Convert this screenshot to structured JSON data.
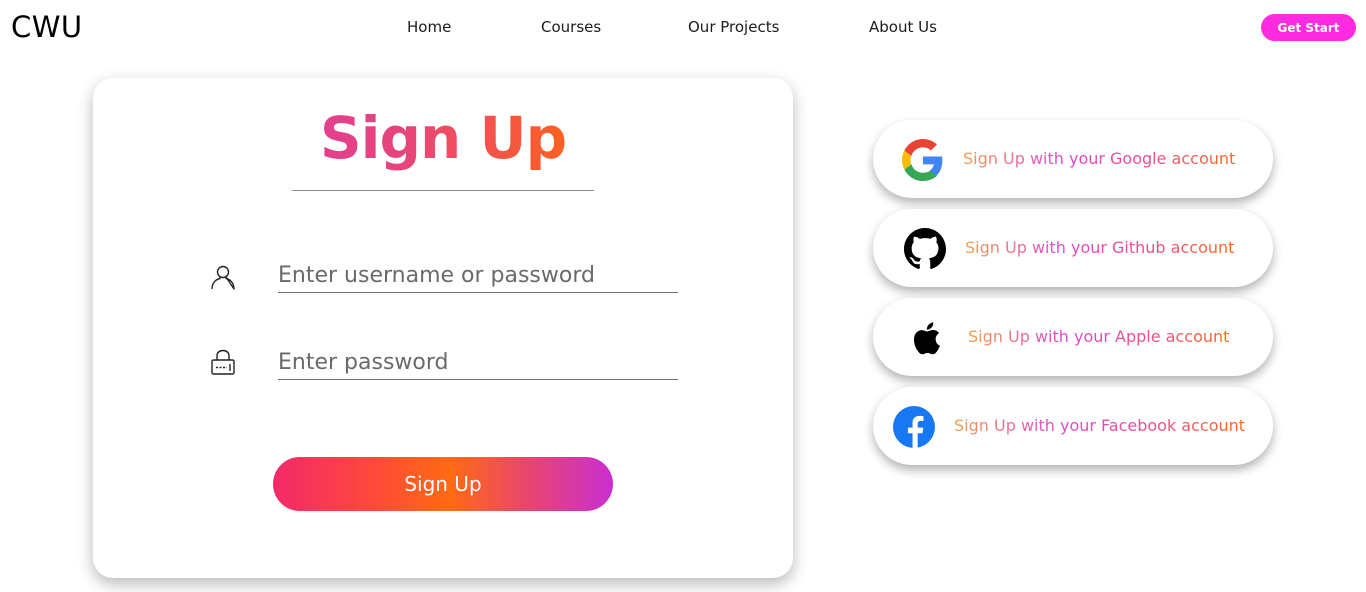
{
  "header": {
    "logo": "CWU",
    "nav": [
      "Home",
      "Courses",
      "Our Projects",
      "About Us"
    ],
    "cta_label": "Get Start"
  },
  "signup_card": {
    "title": "Sign Up",
    "username_placeholder": "Enter username or password",
    "password_placeholder": "Enter password",
    "submit_label": "Sign Up",
    "username_icon": "user-icon",
    "password_icon": "lock-icon"
  },
  "social": [
    {
      "label": "Sign Up with your Google account",
      "icon": "google-icon"
    },
    {
      "label": "Sign Up with your Github account",
      "icon": "github-icon"
    },
    {
      "label": "Sign Up with your Apple account",
      "icon": "apple-icon"
    },
    {
      "label": "Sign Up with your Facebook account",
      "icon": "facebook-icon"
    }
  ],
  "colors": {
    "cta": "#ff2be0",
    "gradient_pink": "#d42fc8",
    "gradient_orange": "#ff6a1a"
  }
}
